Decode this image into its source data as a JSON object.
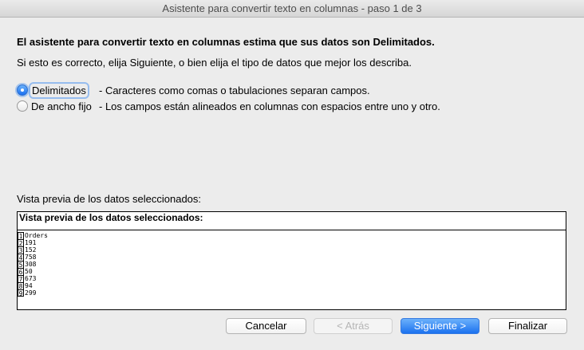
{
  "window": {
    "title": "Asistente para convertir texto en columnas - paso 1 de 3"
  },
  "intro": {
    "heading": "El asistente para convertir texto en columnas estima que sus datos son Delimitados.",
    "subheading": "Si esto es correcto, elija Siguiente, o bien elija el tipo de datos que mejor los describa."
  },
  "options": [
    {
      "label": "Delimitados",
      "description": "- Caracteres como comas o tabulaciones separan campos.",
      "selected": true
    },
    {
      "label": "De ancho fijo",
      "description": "- Los campos están alineados en columnas con espacios entre uno y otro.",
      "selected": false
    }
  ],
  "preview": {
    "caption": "Vista previa de los datos seleccionados:",
    "header": "Vista previa de los datos seleccionados:",
    "rows": [
      {
        "num": "1",
        "text": "Orders"
      },
      {
        "num": "2",
        "text": "191"
      },
      {
        "num": "3",
        "text": "152"
      },
      {
        "num": "4",
        "text": "758"
      },
      {
        "num": "5",
        "text": "308"
      },
      {
        "num": "6",
        "text": "50"
      },
      {
        "num": "7",
        "text": "673"
      },
      {
        "num": "8",
        "text": "94"
      },
      {
        "num": "9",
        "text": "299"
      }
    ]
  },
  "buttons": {
    "cancel": "Cancelar",
    "back": "< Atrás",
    "next": "Siguiente >",
    "finish": "Finalizar"
  },
  "colors": {
    "accent": "#1a6ff0",
    "background": "#ececec"
  }
}
